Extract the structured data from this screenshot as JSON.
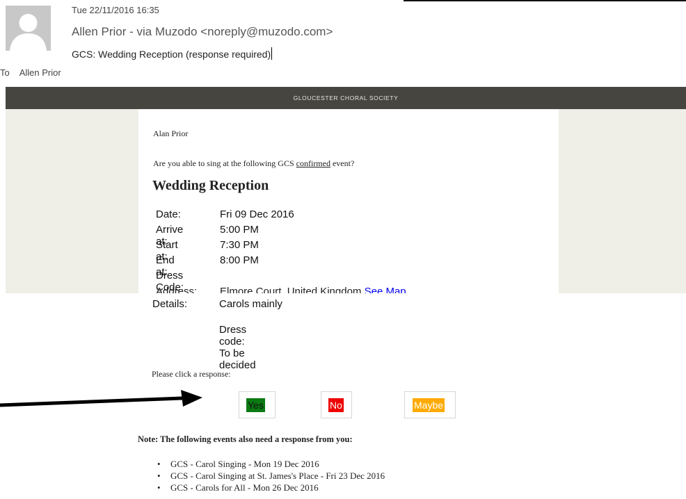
{
  "message": {
    "date": "Tue 22/11/2016 16:35",
    "from": "Allen Prior - via Muzodo <noreply@muzodo.com>",
    "subject": "GCS: Wedding Reception (response required)",
    "to_label": "To",
    "to_name": "Allen Prior"
  },
  "email": {
    "banner": "GLOUCESTER CHORAL SOCIETY",
    "greeting": "Alan Prior",
    "question_before": "Are you able to sing at the following GCS ",
    "question_emph": "confirmed",
    "question_after": " event?",
    "event_title": "Wedding Reception",
    "details": {
      "date_label": "Date:",
      "date_value": "Fri 09 Dec 2016",
      "arrive_label": "Arrive at:",
      "arrive_value": "5:00 PM",
      "start_label": "Start at:",
      "start_value": "7:30 PM",
      "end_label": "End at:",
      "end_value": "8:00 PM",
      "dress_label": "Dress Code:",
      "address_label": "Address:",
      "address_value": "Elmore Court, United Kingdom",
      "see_map": "See Map",
      "details_label": "Details:",
      "details_value": "Carols mainly",
      "dress_note": "Dress code: To be decided"
    },
    "response_prompt": "Please click a response:",
    "buttons": {
      "yes": "Yes",
      "no": "No",
      "maybe": "Maybe"
    },
    "note": "Note: The following events also need a response from you:",
    "other_events": [
      "GCS - Carol Singing - Mon 19 Dec 2016",
      "GCS - Carol Singing at St. James's Place - Fri 23 Dec 2016",
      "GCS - Carols for All - Mon 26 Dec 2016"
    ]
  },
  "colors": {
    "banner": "#46453f",
    "side_panel": "#efefe8",
    "yes": "#0a7a12",
    "no": "#ee0000",
    "maybe": "#ffaa00",
    "link": "#0000ee"
  },
  "icons": {
    "avatar": "person-silhouette-icon",
    "annotation": "arrow-right-icon"
  }
}
